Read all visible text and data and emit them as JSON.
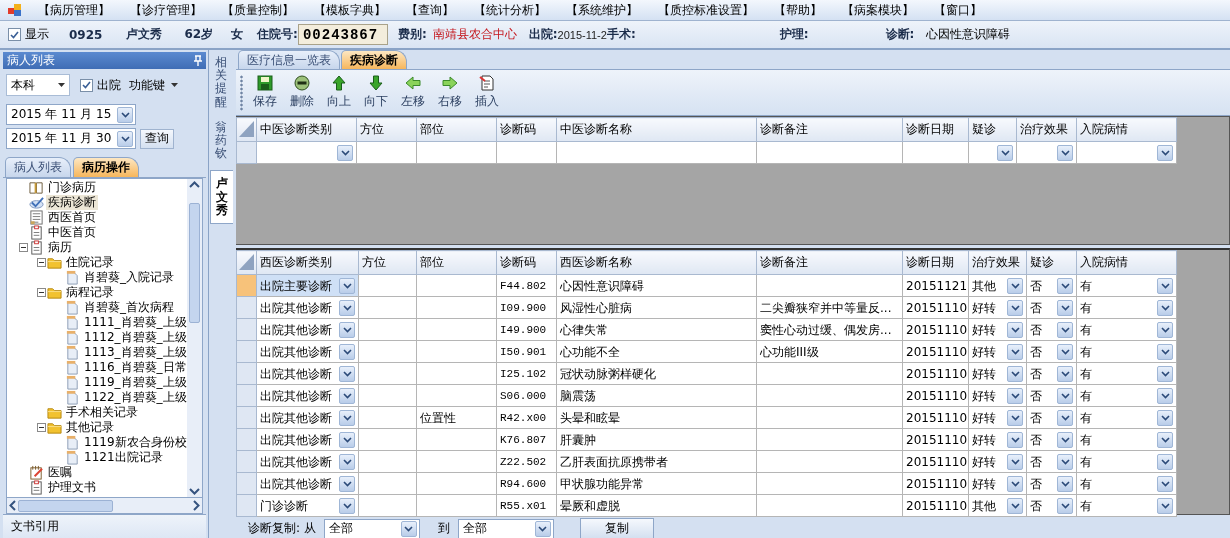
{
  "menu": [
    "【病历管理】",
    "【诊疗管理】",
    "【质量控制】",
    "【模板字典】",
    "【查询】",
    "【统计分析】",
    "【系统维护】",
    "【质控标准设置】",
    "【帮助】",
    "【病案模块】",
    "【窗口】"
  ],
  "info_bar": {
    "show_checkbox": {
      "label": "显示",
      "checked": true
    },
    "patient_no": "0925",
    "name": "卢文秀",
    "age": "62岁",
    "sex": "女",
    "admission_no": {
      "label": "住院号:",
      "value": "00243867"
    },
    "fee_type": {
      "label": "费别:",
      "value": "南靖县农合中心"
    },
    "discharge": {
      "label": "出院:",
      "value": "2015-11-2"
    },
    "surgery": {
      "label": "手术:"
    },
    "nursing": {
      "label": "护理:"
    },
    "diagnosis": {
      "label": "诊断:",
      "value": "心因性意识障碍"
    }
  },
  "patient_panel": {
    "title": "病人列表",
    "department": "本科",
    "discharged": {
      "label": "出院",
      "checked": true
    },
    "function_keys": "功能键",
    "date_from": "2015 年 11 月 15",
    "date_to": "2015 年 11 月 30",
    "query_button": "查询",
    "tabs": [
      {
        "label": "病人列表",
        "selected": false
      },
      {
        "label": "病历操作",
        "selected": true
      }
    ],
    "tree": [
      {
        "label": "门诊病历",
        "kind": "book",
        "selected": false
      },
      {
        "label": "疾病诊断",
        "kind": "check",
        "selected": true
      },
      {
        "label": "西医首页",
        "kind": "page",
        "selected": false
      },
      {
        "label": "中医首页",
        "kind": "form",
        "selected": false
      },
      {
        "label": "病历",
        "kind": "form",
        "selected": false,
        "expanded": true,
        "children": [
          {
            "label": "住院记录",
            "kind": "folder",
            "selected": false,
            "expanded": true,
            "children": [
              {
                "label": "肖碧葵_入院记录",
                "kind": "record",
                "selected": false
              }
            ]
          },
          {
            "label": "病程记录",
            "kind": "folder",
            "selected": false,
            "expanded": true,
            "children": [
              {
                "label": "肖碧葵_首次病程",
                "kind": "record",
                "selected": false
              },
              {
                "label": "1111_肖碧葵_上级",
                "kind": "record",
                "selected": false
              },
              {
                "label": "1112_肖碧葵_上级",
                "kind": "record",
                "selected": false
              },
              {
                "label": "1113_肖碧葵_上级",
                "kind": "record",
                "selected": false
              },
              {
                "label": "1116_肖碧葵_日常",
                "kind": "record",
                "selected": false
              },
              {
                "label": "1119_肖碧葵_上级",
                "kind": "record",
                "selected": false
              },
              {
                "label": "1122_肖碧葵_上级",
                "kind": "record",
                "selected": false
              }
            ]
          },
          {
            "label": "手术相关记录",
            "kind": "folder",
            "selected": false
          },
          {
            "label": "其他记录",
            "kind": "folder",
            "selected": false,
            "expanded": true,
            "children": [
              {
                "label": "1119新农合身份校",
                "kind": "record",
                "selected": false
              },
              {
                "label": "1121出院记录",
                "kind": "record",
                "selected": false
              }
            ]
          }
        ]
      },
      {
        "label": "医嘱",
        "kind": "note",
        "selected": false
      },
      {
        "label": "护理文书",
        "kind": "form",
        "selected": false
      }
    ],
    "footer": "文书引用"
  },
  "side_tabs": [
    {
      "label": "相关提醒",
      "selected": false
    },
    {
      "label": "翁药钦",
      "selected": false
    },
    {
      "label": "卢文秀",
      "selected": true
    }
  ],
  "main_tabs": [
    {
      "label": "医疗信息一览表",
      "selected": false
    },
    {
      "label": "疾病诊断",
      "selected": true
    }
  ],
  "toolbar": [
    "保存",
    "删除",
    "向上",
    "向下",
    "左移",
    "右移",
    "插入"
  ],
  "tcm_grid": {
    "columns": [
      {
        "label": "中医诊断类别",
        "kind": "combo"
      },
      {
        "label": "方位",
        "kind": "text"
      },
      {
        "label": "部位",
        "kind": "text"
      },
      {
        "label": "诊断码",
        "kind": "text"
      },
      {
        "label": "中医诊断名称",
        "kind": "text"
      },
      {
        "label": "诊断备注",
        "kind": "text"
      },
      {
        "label": "诊断日期",
        "kind": "text"
      },
      {
        "label": "疑诊",
        "kind": "combo"
      },
      {
        "label": "治疗效果",
        "kind": "combo"
      },
      {
        "label": "入院病情",
        "kind": "combo"
      }
    ]
  },
  "western_grid": {
    "columns": [
      {
        "label": "西医诊断类别",
        "kind": "combo"
      },
      {
        "label": "方位",
        "kind": "text"
      },
      {
        "label": "部位",
        "kind": "text"
      },
      {
        "label": "诊断码",
        "kind": "code"
      },
      {
        "label": "西医诊断名称",
        "kind": "text"
      },
      {
        "label": "诊断备注",
        "kind": "text"
      },
      {
        "label": "诊断日期",
        "kind": "text"
      },
      {
        "label": "治疗效果",
        "kind": "combo"
      },
      {
        "label": "疑诊",
        "kind": "combo"
      },
      {
        "label": "入院病情",
        "kind": "combo"
      }
    ],
    "rows": [
      {
        "selected": true,
        "cells": [
          "出院主要诊断",
          null,
          null,
          "F44.802",
          "心因性意识障碍",
          null,
          "20151121",
          "其他",
          "否",
          "有"
        ]
      },
      {
        "selected": false,
        "cells": [
          "出院其他诊断",
          null,
          null,
          "I09.900",
          "风湿性心脏病",
          "二尖瓣狭窄并中等量反...",
          "20151110",
          "好转",
          "否",
          "有"
        ]
      },
      {
        "selected": false,
        "cells": [
          "出院其他诊断",
          null,
          null,
          "I49.900",
          "心律失常",
          "窦性心动过缓、偶发房...",
          "20151110",
          "好转",
          "否",
          "有"
        ]
      },
      {
        "selected": false,
        "cells": [
          "出院其他诊断",
          null,
          null,
          "I50.901",
          "心功能不全",
          "心功能III级",
          "20151110",
          "好转",
          "否",
          "有"
        ]
      },
      {
        "selected": false,
        "cells": [
          "出院其他诊断",
          null,
          null,
          "I25.102",
          "冠状动脉粥样硬化",
          null,
          "20151110",
          "好转",
          "否",
          "有"
        ]
      },
      {
        "selected": false,
        "cells": [
          "出院其他诊断",
          null,
          null,
          "S06.000",
          "脑震荡",
          null,
          "20151110",
          "好转",
          "否",
          "有"
        ]
      },
      {
        "selected": false,
        "cells": [
          "出院其他诊断",
          null,
          "位置性",
          "R42.x00",
          "头晕和眩晕",
          null,
          "20151110",
          "好转",
          "否",
          "有"
        ]
      },
      {
        "selected": false,
        "cells": [
          "出院其他诊断",
          null,
          null,
          "K76.807",
          "肝囊肿",
          null,
          "20151110",
          "好转",
          "否",
          "有"
        ]
      },
      {
        "selected": false,
        "cells": [
          "出院其他诊断",
          null,
          null,
          "Z22.502",
          "乙肝表面抗原携带者",
          null,
          "20151110",
          "好转",
          "否",
          "有"
        ]
      },
      {
        "selected": false,
        "cells": [
          "出院其他诊断",
          null,
          null,
          "R94.600",
          "甲状腺功能异常",
          null,
          "20151110",
          "好转",
          "否",
          "有"
        ]
      },
      {
        "selected": false,
        "cells": [
          "门诊诊断",
          null,
          null,
          "R55.x01",
          "晕厥和虚脱",
          null,
          "20151110",
          "其他",
          "否",
          "有"
        ]
      }
    ]
  },
  "copy_bar": {
    "label": "诊断复制: 从",
    "from": "全部",
    "to_label": "到",
    "to": "全部",
    "button": "复制"
  }
}
